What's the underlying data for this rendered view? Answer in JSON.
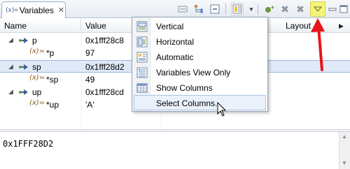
{
  "view": {
    "tab_title": "Variables",
    "tab_icon_text": "(x)=",
    "close_glyph": "✕"
  },
  "toolbar": {
    "icons": [
      "show-type-names-icon",
      "show-logical-structure-icon",
      "collapse-all-icon",
      "select-layout-icon",
      "dropdown-arrow-icon",
      "add-global-variables-icon",
      "remove-global-variables-icon",
      "remove-all-global-variables-icon",
      "view-menu-icon",
      "minimize-icon",
      "maximize-icon"
    ],
    "view_menu_highlight_color": "#f3f47a"
  },
  "table": {
    "columns": [
      "Name",
      "Value"
    ],
    "layout_label": "Layout",
    "layout_arrow": "▶",
    "rows": [
      {
        "name": "p",
        "value": "0x1fff28c8",
        "expanded": true,
        "kind": "pointer"
      },
      {
        "name": "*p",
        "value": "97",
        "kind": "variable"
      },
      {
        "name": "sp",
        "value": "0x1fff28d2",
        "expanded": true,
        "kind": "pointer",
        "selected": true
      },
      {
        "name": "*sp",
        "value": "49",
        "kind": "variable"
      },
      {
        "name": "up",
        "value": "0x1fff28cd",
        "expanded": true,
        "kind": "pointer"
      },
      {
        "name": "*up",
        "value": "'A'",
        "kind": "variable"
      }
    ],
    "twisty_glyph": "◢"
  },
  "detail": {
    "text": "0x1FFF28D2"
  },
  "view_menu": {
    "items": [
      {
        "label": "Vertical",
        "icon": "layout-vertical-icon"
      },
      {
        "label": "Horizontal",
        "icon": "layout-horizontal-icon"
      },
      {
        "label": "Automatic",
        "icon": "layout-automatic-icon"
      },
      {
        "label": "Variables View Only",
        "icon": "variables-only-icon"
      },
      {
        "label": "Show Columns",
        "icon": "show-columns-icon"
      },
      {
        "label": "Select Columns...",
        "icon": "",
        "hovered": true
      }
    ]
  },
  "annotation": {
    "arrow_color": "#e8141c"
  }
}
